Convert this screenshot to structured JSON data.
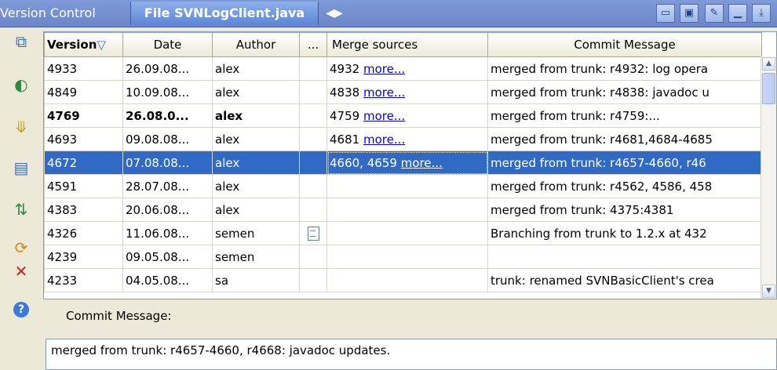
{
  "tabs": {
    "inactive": "Version Control",
    "active": "File SVNLogClient.java History",
    "arrows": "◀▶"
  },
  "table": {
    "headers": {
      "version": "Version",
      "sort_indicator": "▽",
      "date": "Date",
      "author": "Author",
      "extra": "...",
      "merge": "Merge sources",
      "message": "Commit Message"
    },
    "rows": [
      {
        "version": "4933",
        "date": "26.09.08...",
        "author": "alex",
        "merge": "4932",
        "more": "more...",
        "message": "merged from trunk: r4932: log opera"
      },
      {
        "version": "4849",
        "date": "10.09.08...",
        "author": "alex",
        "merge": "4838",
        "more": "more...",
        "message": "merged from trunk: r4838: javadoc u"
      },
      {
        "version": "4769",
        "date": "26.08.0...",
        "author": "alex",
        "merge": "4759",
        "more": "more...",
        "message": "merged from trunk: r4759:..."
      },
      {
        "version": "4693",
        "date": "09.08.08...",
        "author": "alex",
        "merge": "4681",
        "more": "more...",
        "message": "merged from trunk: r4681,4684-4685"
      },
      {
        "version": "4672",
        "date": "07.08.08...",
        "author": "alex",
        "merge": "4660, 4659",
        "more": "more...",
        "message": "merged from trunk: r4657-4660, r46"
      },
      {
        "version": "4591",
        "date": "28.07.08...",
        "author": "alex",
        "merge": "",
        "more": "",
        "message": "merged from trunk: r4562, 4586, 458"
      },
      {
        "version": "4383",
        "date": "20.06.08...",
        "author": "alex",
        "merge": "",
        "more": "",
        "message": "merged from trunk: 4375:4381"
      },
      {
        "version": "4326",
        "date": "11.06.08...",
        "author": "semen",
        "merge": "",
        "more": "",
        "message": "Branching from trunk to 1.2.x at 432"
      },
      {
        "version": "4239",
        "date": "09.05.08...",
        "author": "semen",
        "merge": "",
        "more": "",
        "message": ""
      },
      {
        "version": "4233",
        "date": "04.05.08...",
        "author": "sa",
        "merge": "",
        "more": "",
        "message": "trunk: renamed SVNBasicClient's crea"
      }
    ]
  },
  "commit_message": {
    "label": "Commit Message:",
    "value": "merged from trunk: r4657-4660, r4668: javadoc updates."
  },
  "colors": {
    "selection": "#316ac5",
    "tabbar": "#6d86c8",
    "link": "#0000ee"
  }
}
